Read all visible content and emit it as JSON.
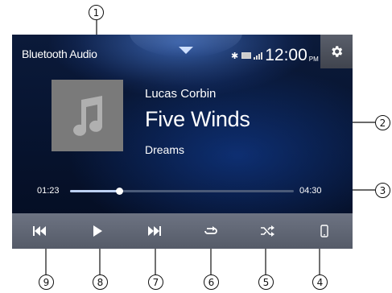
{
  "header": {
    "title": "Bluetooth Audio",
    "clock": "12:00",
    "ampm": "PM"
  },
  "track": {
    "artist": "Lucas Corbin",
    "song": "Five Winds",
    "album": "Dreams",
    "elapsed": "01:23",
    "duration": "04:30",
    "progress": 0.22
  },
  "controls": [
    "previous-track",
    "play",
    "next-track",
    "repeat",
    "shuffle",
    "phone"
  ],
  "callouts": [
    "1",
    "2",
    "3",
    "4",
    "5",
    "6",
    "7",
    "8",
    "9"
  ]
}
